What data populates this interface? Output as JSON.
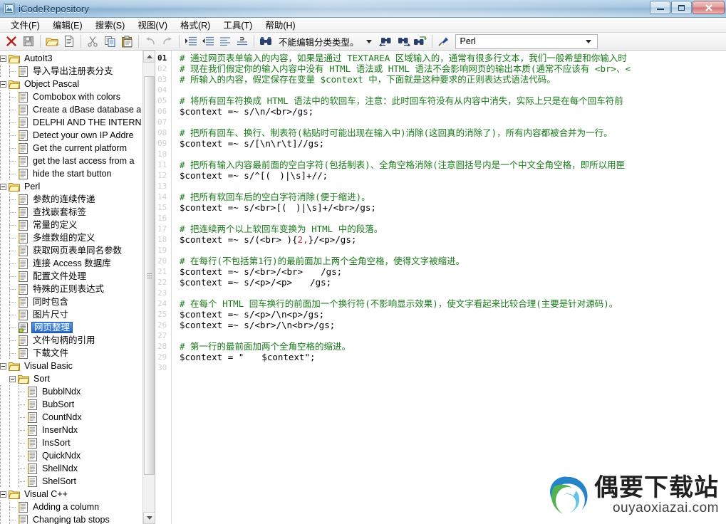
{
  "window": {
    "title": "iCodeRepository",
    "icon": "app-icon",
    "buttons": {
      "minimize": "–",
      "maximize": "□",
      "close": "✕"
    }
  },
  "menubar": {
    "items": [
      {
        "name": "file",
        "label": "文件(F)"
      },
      {
        "name": "edit",
        "label": "编辑(E)"
      },
      {
        "name": "search",
        "label": "搜索(S)"
      },
      {
        "name": "view",
        "label": "视图(V)"
      },
      {
        "name": "format",
        "label": "格式(R)"
      },
      {
        "name": "tools",
        "label": "工具(T)"
      },
      {
        "name": "help",
        "label": "帮助(H)"
      }
    ]
  },
  "toolbar": {
    "buttons": [
      {
        "name": "delete-button",
        "icon": "red-x-icon"
      },
      {
        "name": "save-button",
        "icon": "save-disk-icon"
      },
      {
        "name": "open-folder-button",
        "icon": "folder-icon"
      },
      {
        "name": "new-document-button",
        "icon": "document-icon"
      },
      {
        "name": "cut-button",
        "icon": "scissors-icon"
      },
      {
        "name": "copy-button",
        "icon": "copy-icon"
      },
      {
        "name": "paste-button",
        "icon": "clipboard-icon"
      },
      {
        "name": "undo-button",
        "icon": "undo-arrow-icon"
      },
      {
        "name": "redo-button",
        "icon": "redo-arrow-icon"
      },
      {
        "name": "indent-increase-button",
        "icon": "indent-increase-icon"
      },
      {
        "name": "indent-decrease-button",
        "icon": "indent-decrease-icon"
      },
      {
        "name": "align-left-button",
        "icon": "align-left-icon"
      },
      {
        "name": "align-other-button",
        "icon": "align-other-icon"
      },
      {
        "name": "find-button",
        "icon": "binoculars-icon"
      }
    ],
    "status_dropdown": {
      "label": "不能编辑分类类型。",
      "caret": "chevron-down-icon"
    },
    "find-prev": {
      "name": "find-previous-button",
      "icon": "binoculars-left-icon"
    },
    "find-next": {
      "name": "find-next-button",
      "icon": "binoculars-right-icon"
    },
    "find-replace": {
      "name": "find-replace-button",
      "icon": "binoculars-replace-icon"
    },
    "language": {
      "icon": "pen-icon",
      "value": "Perl",
      "caret": "chevron-down-icon"
    }
  },
  "tree": {
    "nodes": [
      {
        "depth": 0,
        "type": "folder",
        "label": "AutoIt3",
        "expanded": true,
        "selected": false
      },
      {
        "depth": 1,
        "type": "doc",
        "label": "导入导出注册表分支",
        "selected": false
      },
      {
        "depth": 0,
        "type": "folder",
        "label": "Object Pascal",
        "expanded": true,
        "selected": false
      },
      {
        "depth": 1,
        "type": "doc",
        "label": "Combobox with colors",
        "selected": false
      },
      {
        "depth": 1,
        "type": "doc",
        "label": "Create a dBase database a",
        "selected": false
      },
      {
        "depth": 1,
        "type": "doc",
        "label": "DELPHI AND THE INTERN",
        "selected": false
      },
      {
        "depth": 1,
        "type": "doc",
        "label": "Detect your own IP Addre",
        "selected": false
      },
      {
        "depth": 1,
        "type": "doc",
        "label": "Get the current platform",
        "selected": false
      },
      {
        "depth": 1,
        "type": "doc",
        "label": "get the last access from a",
        "selected": false
      },
      {
        "depth": 1,
        "type": "doc",
        "label": "hide the start button",
        "selected": false
      },
      {
        "depth": 0,
        "type": "folder",
        "label": "Perl",
        "expanded": true,
        "selected": false
      },
      {
        "depth": 1,
        "type": "doc",
        "label": "参数的连续传递",
        "selected": false
      },
      {
        "depth": 1,
        "type": "doc",
        "label": "查找嵌套标签",
        "selected": false
      },
      {
        "depth": 1,
        "type": "doc",
        "label": "常量的定义",
        "selected": false
      },
      {
        "depth": 1,
        "type": "doc",
        "label": "多维数组的定义",
        "selected": false
      },
      {
        "depth": 1,
        "type": "doc",
        "label": "获取网页表单同名参数",
        "selected": false
      },
      {
        "depth": 1,
        "type": "doc",
        "label": "连接 Access 数据库",
        "selected": false
      },
      {
        "depth": 1,
        "type": "doc",
        "label": "配置文件处理",
        "selected": false
      },
      {
        "depth": 1,
        "type": "doc",
        "label": "特殊的正则表达式",
        "selected": false
      },
      {
        "depth": 1,
        "type": "doc",
        "label": "同时包含",
        "selected": false
      },
      {
        "depth": 1,
        "type": "doc",
        "label": "图片尺寸",
        "selected": false
      },
      {
        "depth": 1,
        "type": "doc",
        "label": "网页整理",
        "selected": true
      },
      {
        "depth": 1,
        "type": "doc",
        "label": "文件句柄的引用",
        "selected": false
      },
      {
        "depth": 1,
        "type": "doc",
        "label": "下载文件",
        "selected": false
      },
      {
        "depth": 0,
        "type": "folder",
        "label": "Visual Basic",
        "expanded": true,
        "selected": false
      },
      {
        "depth": 1,
        "type": "folder",
        "label": "Sort",
        "expanded": true,
        "selected": false
      },
      {
        "depth": 2,
        "type": "doc",
        "label": "BubblNdx",
        "selected": false
      },
      {
        "depth": 2,
        "type": "doc",
        "label": "BubSort",
        "selected": false
      },
      {
        "depth": 2,
        "type": "doc",
        "label": "CountNdx",
        "selected": false
      },
      {
        "depth": 2,
        "type": "doc",
        "label": "InserNdx",
        "selected": false
      },
      {
        "depth": 2,
        "type": "doc",
        "label": "InsSort",
        "selected": false
      },
      {
        "depth": 2,
        "type": "doc",
        "label": "QuickNdx",
        "selected": false
      },
      {
        "depth": 2,
        "type": "doc",
        "label": "ShellNdx",
        "selected": false
      },
      {
        "depth": 2,
        "type": "doc",
        "label": "ShelSort",
        "selected": false
      },
      {
        "depth": 0,
        "type": "folder",
        "label": "Visual C++",
        "expanded": true,
        "selected": false
      },
      {
        "depth": 1,
        "type": "doc",
        "label": "Adding a column",
        "selected": false
      },
      {
        "depth": 1,
        "type": "doc",
        "label": "Changing tab stops",
        "selected": false
      }
    ]
  },
  "editor": {
    "language": "Perl",
    "current_line": 1,
    "line_numbers": [
      "01",
      "02",
      "03",
      "04",
      "05",
      "06",
      "07",
      "08",
      "09",
      "10",
      "11",
      "12",
      "13",
      "14",
      "15",
      "16",
      "17",
      "18",
      "19",
      "20",
      "21",
      "22",
      "23",
      "24",
      "25",
      "26",
      "27",
      "28",
      "29",
      "30"
    ],
    "lines": [
      {
        "n": "01",
        "kind": "comment",
        "text": "# 通过网页表单输入的内容，如果是通过 TEXTAREA 区域输入的，通常有很多行文本，我们一般希望和你输入时"
      },
      {
        "n": "02",
        "kind": "comment",
        "text": "# 现在我们假定你的输入内容中没有 HTML 语法或 HTML 语法不会影响网页的输出本质(通常不应该有 <br>、<"
      },
      {
        "n": "03",
        "kind": "comment",
        "text": "# 所输入的内容，假定保存在变量 $context 中，下面就是这种要求的正则表达式语法代码。"
      },
      {
        "n": "04",
        "kind": "blank",
        "text": ""
      },
      {
        "n": "05",
        "kind": "comment",
        "text": "# 将所有回车符换成 HTML 语法中的软回车，注意：此时回车符没有从内容中消失，实际上只是在每个回车符前"
      },
      {
        "n": "06",
        "kind": "code",
        "text": "$context =~ s/\\n/<br>/gs;"
      },
      {
        "n": "07",
        "kind": "blank",
        "text": ""
      },
      {
        "n": "08",
        "kind": "comment",
        "text": "# 把所有回车、换行、制表符(粘贴时可能出现在输入中)消除(这回真的消除了)，所有内容都被合并为一行。"
      },
      {
        "n": "09",
        "kind": "code",
        "text": "$context =~ s/[\\n\\r\\t]//gs;"
      },
      {
        "n": "10",
        "kind": "blank",
        "text": ""
      },
      {
        "n": "11",
        "kind": "comment",
        "text": "# 把所有输入内容最前面的空白字符(包括制表)、全角空格消除(注意圆括号内是一个中文全角空格，即所以用匣"
      },
      {
        "n": "12",
        "kind": "code",
        "text": "$context =~ s/^[(　)|\\s]+//;"
      },
      {
        "n": "13",
        "kind": "blank",
        "text": ""
      },
      {
        "n": "14",
        "kind": "comment",
        "text": "# 把所有软回车后的空白字符消除(便于缩进)。"
      },
      {
        "n": "15",
        "kind": "code",
        "text": "$context =~ s/<br>[(　)|\\s]+/<br>/gs;"
      },
      {
        "n": "16",
        "kind": "blank",
        "text": ""
      },
      {
        "n": "17",
        "kind": "comment",
        "text": "# 把连续两个以上软回车变换为 HTML 中的段落。"
      },
      {
        "n": "18",
        "kind": "code",
        "text": "$context =~ s/(<br> ){2,}/<p>/gs;",
        "highlight_number": "2,"
      },
      {
        "n": "19",
        "kind": "blank",
        "text": ""
      },
      {
        "n": "20",
        "kind": "comment",
        "text": "# 在每行(不包括第1行)的最前面加上两个全角空格，使得文字被缩进。"
      },
      {
        "n": "21",
        "kind": "code",
        "text": "$context =~ s/<br>/<br>　　/gs;"
      },
      {
        "n": "22",
        "kind": "code",
        "text": "$context =~ s/<p>/<p>　　/gs;"
      },
      {
        "n": "23",
        "kind": "blank",
        "text": ""
      },
      {
        "n": "24",
        "kind": "comment",
        "text": "# 在每个 HTML 回车换行的前面加一个换行符(不影响显示效果)，使文字看起来比较合理(主要是针对源码)。"
      },
      {
        "n": "25",
        "kind": "code",
        "text": "$context =~ s/<p>/\\n<p>/gs;"
      },
      {
        "n": "26",
        "kind": "code",
        "text": "$context =~ s/<br>/\\n<br>/gs;"
      },
      {
        "n": "27",
        "kind": "blank",
        "text": ""
      },
      {
        "n": "28",
        "kind": "comment",
        "text": "# 第一行的最前面加两个全角空格的缩进。"
      },
      {
        "n": "29",
        "kind": "code",
        "text": "$context = \"　　$context\";"
      },
      {
        "n": "30",
        "kind": "blank",
        "text": ""
      }
    ]
  },
  "watermark": {
    "cn": "偶要下载站",
    "en": "ouyaoxiazai.com"
  },
  "colors": {
    "comment": "#1a7a1a",
    "code": "#000000",
    "number": "#c03030",
    "selection": "#2766c4",
    "title_bar": "#9cc0de"
  }
}
